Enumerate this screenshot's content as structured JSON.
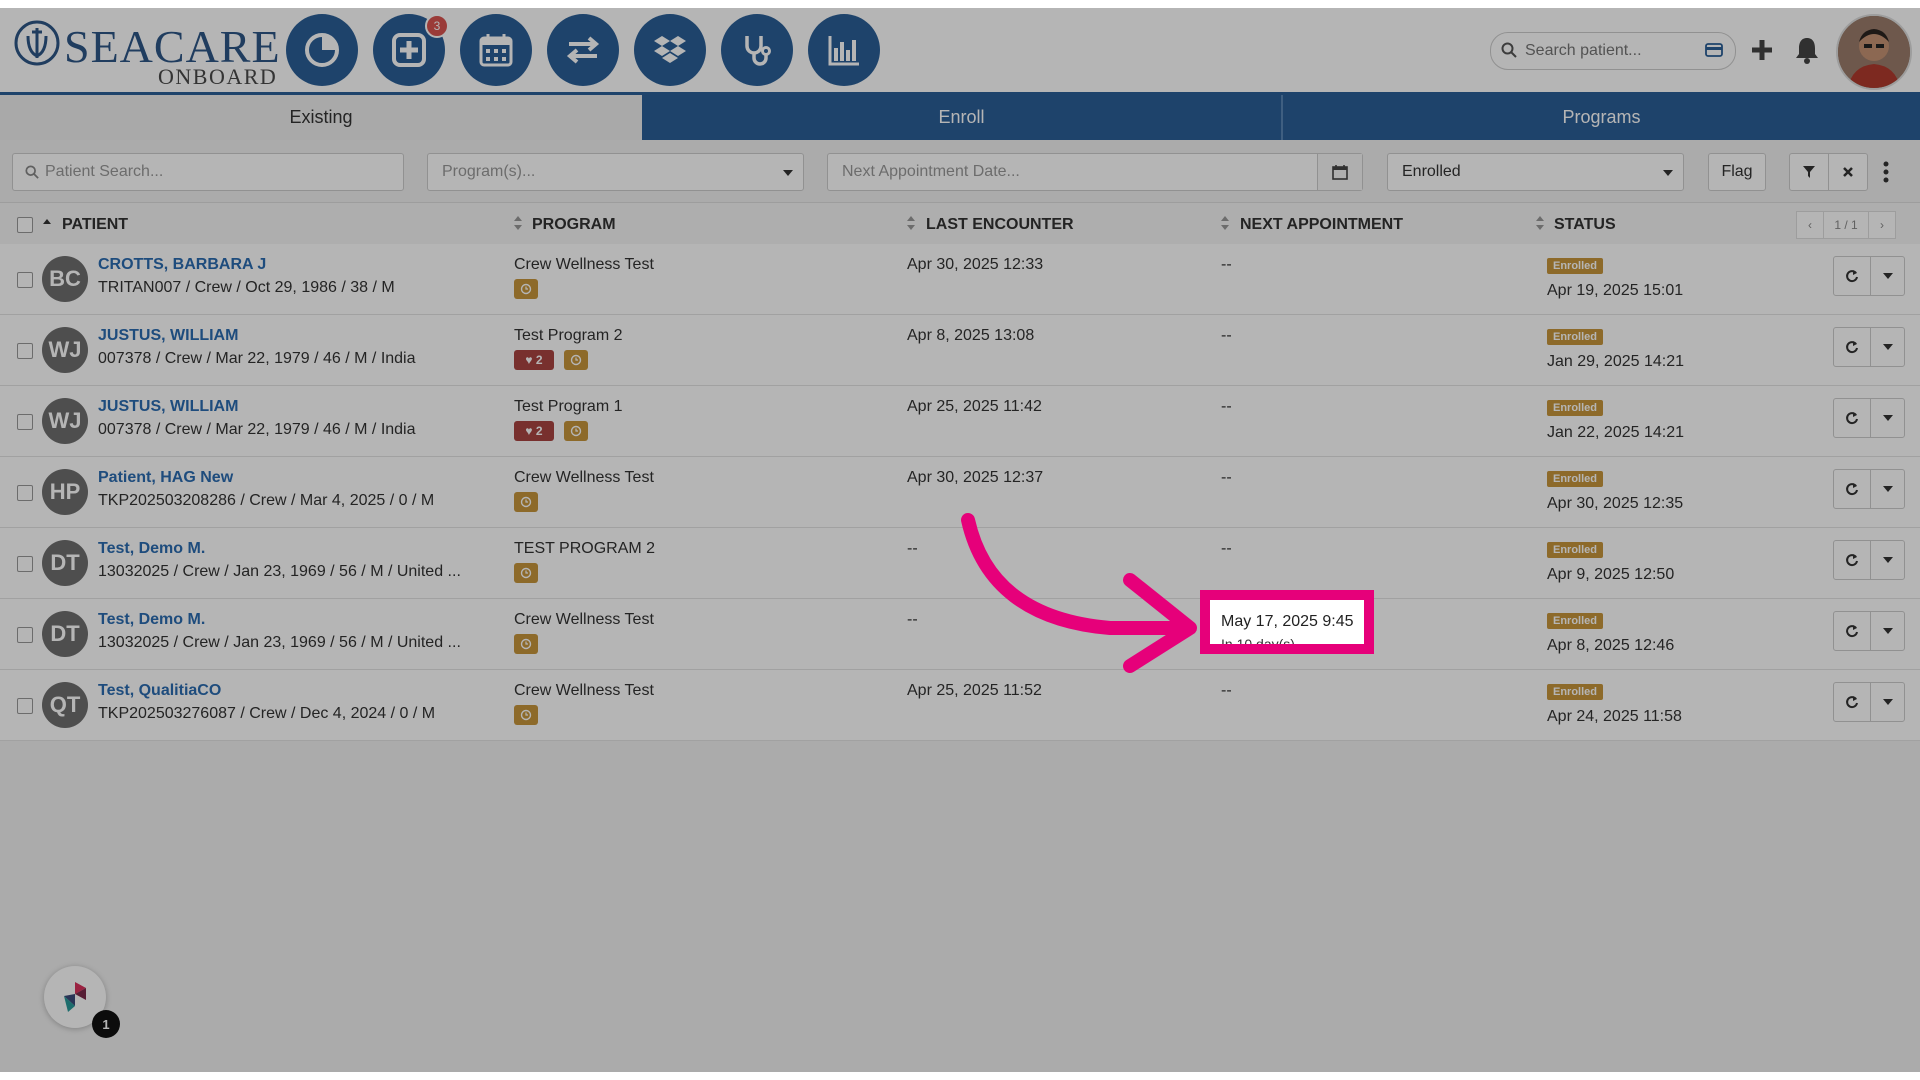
{
  "brand": {
    "name": "SEACARE",
    "subtitle": "ONBOARD"
  },
  "nav": {
    "icons": [
      "dashboard-pie-icon",
      "add-patient-icon",
      "calendar-icon",
      "transfer-icon",
      "dropbox-icon",
      "stethoscope-icon",
      "bar-chart-icon"
    ],
    "add_badge": "3"
  },
  "top_search": {
    "placeholder": "Search patient..."
  },
  "tabs": {
    "existing": "Existing",
    "enroll": "Enroll",
    "programs": "Programs"
  },
  "filters": {
    "patient_search_placeholder": "Patient Search...",
    "programs_placeholder": "Program(s)...",
    "next_appt_placeholder": "Next Appointment Date...",
    "status_value": "Enrolled",
    "flag_label": "Flag"
  },
  "columns": {
    "patient": "PATIENT",
    "program": "PROGRAM",
    "last_encounter": "LAST ENCOUNTER",
    "next_appointment": "NEXT APPOINTMENT",
    "status": "STATUS"
  },
  "pager": {
    "prev": "‹",
    "page": "1 / 1",
    "next": "›"
  },
  "rows": [
    {
      "initials": "BC",
      "name": "CROTTS, BARBARA J",
      "details": "TRITAN007 / Crew / Oct 29, 1986 / 38 / M",
      "program": "Crew Wellness Test",
      "heart": "",
      "last": "Apr 30, 2025 12:33",
      "next": "--",
      "status": "Enrolled",
      "status_date": "Apr 19, 2025 15:01"
    },
    {
      "initials": "WJ",
      "name": "JUSTUS, WILLIAM",
      "details": "007378 / Crew / Mar 22, 1979 / 46 / M / India",
      "program": "Test Program 2",
      "heart": "♥ 2",
      "last": "Apr 8, 2025 13:08",
      "next": "--",
      "status": "Enrolled",
      "status_date": "Jan 29, 2025 14:21"
    },
    {
      "initials": "WJ",
      "name": "JUSTUS, WILLIAM",
      "details": "007378 / Crew / Mar 22, 1979 / 46 / M / India",
      "program": "Test Program 1",
      "heart": "♥ 2",
      "last": "Apr 25, 2025 11:42",
      "next": "--",
      "status": "Enrolled",
      "status_date": "Jan 22, 2025 14:21"
    },
    {
      "initials": "HP",
      "name": "Patient, HAG New",
      "details": "TKP202503208286 / Crew / Mar 4, 2025 / 0 / M",
      "program": "Crew Wellness Test",
      "heart": "",
      "last": "Apr 30, 2025 12:37",
      "next": "--",
      "status": "Enrolled",
      "status_date": "Apr 30, 2025 12:35"
    },
    {
      "initials": "DT",
      "name": "Test, Demo M.",
      "details": "13032025 / Crew / Jan 23, 1969 / 56 / M / United ...",
      "program": "TEST PROGRAM 2",
      "heart": "",
      "last": "--",
      "next": "--",
      "status": "Enrolled",
      "status_date": "Apr 9, 2025 12:50"
    },
    {
      "initials": "DT",
      "name": "Test, Demo M.",
      "details": "13032025 / Crew / Jan 23, 1969 / 56 / M / United ...",
      "program": "Crew Wellness Test",
      "heart": "",
      "last": "--",
      "next": "",
      "status": "Enrolled",
      "status_date": "Apr 8, 2025 12:46"
    },
    {
      "initials": "QT",
      "name": "Test, QualitiaCO",
      "details": "TKP202503276087 / Crew / Dec 4, 2024 / 0 / M",
      "program": "Crew Wellness Test",
      "heart": "",
      "last": "Apr 25, 2025 11:52",
      "next": "--",
      "status": "Enrolled",
      "status_date": "Apr 24, 2025 11:58"
    }
  ],
  "highlight": {
    "date": "May 17, 2025 9:45",
    "sub": "In 10 day(s)",
    "color": "#e6007a"
  },
  "widget": {
    "badge": "1"
  }
}
